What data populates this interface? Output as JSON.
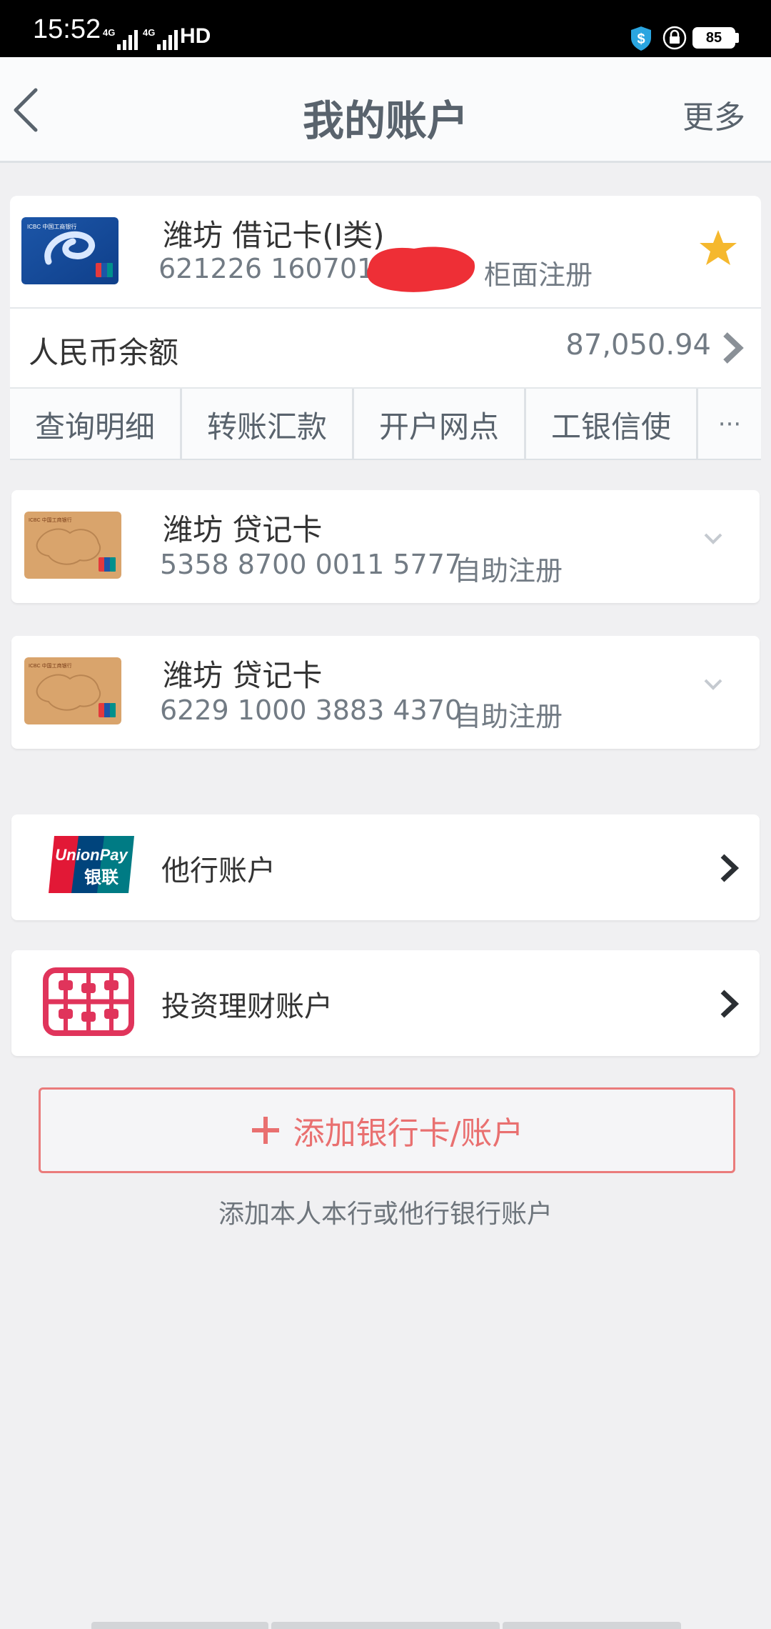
{
  "status_bar": {
    "time": "15:52",
    "net_1": "4G",
    "net_2": "4G",
    "hd": "HD",
    "battery": "85"
  },
  "nav": {
    "title": "我的账户",
    "more": "更多"
  },
  "primary_account": {
    "name": "潍坊 借记卡(I类)",
    "number": "621226 1607012",
    "registration": "柜面注册",
    "balance_label": "人民币余额",
    "balance_value": "87,050.94",
    "starred": true
  },
  "actions": [
    {
      "label": "查询明细"
    },
    {
      "label": "转账汇款"
    },
    {
      "label": "开户网点"
    },
    {
      "label": "工银信使"
    },
    {
      "label": "···"
    }
  ],
  "credit_cards": [
    {
      "name": "潍坊 贷记卡",
      "number": "5358 8700 0011 5777",
      "registration": "自助注册"
    },
    {
      "name": "潍坊 贷记卡",
      "number": "6229 1000 3883 4370",
      "registration": "自助注册"
    }
  ],
  "links": {
    "other_bank": "他行账户",
    "investment": "投资理财账户"
  },
  "unionpay": {
    "en": "UnionPay",
    "cn": "银联"
  },
  "add": {
    "label": "添加银行卡/账户",
    "hint": "添加本人本行或他行银行账户"
  },
  "colors": {
    "accent_red": "#e97070",
    "star": "#f5b82e",
    "text_muted": "#727b84"
  }
}
